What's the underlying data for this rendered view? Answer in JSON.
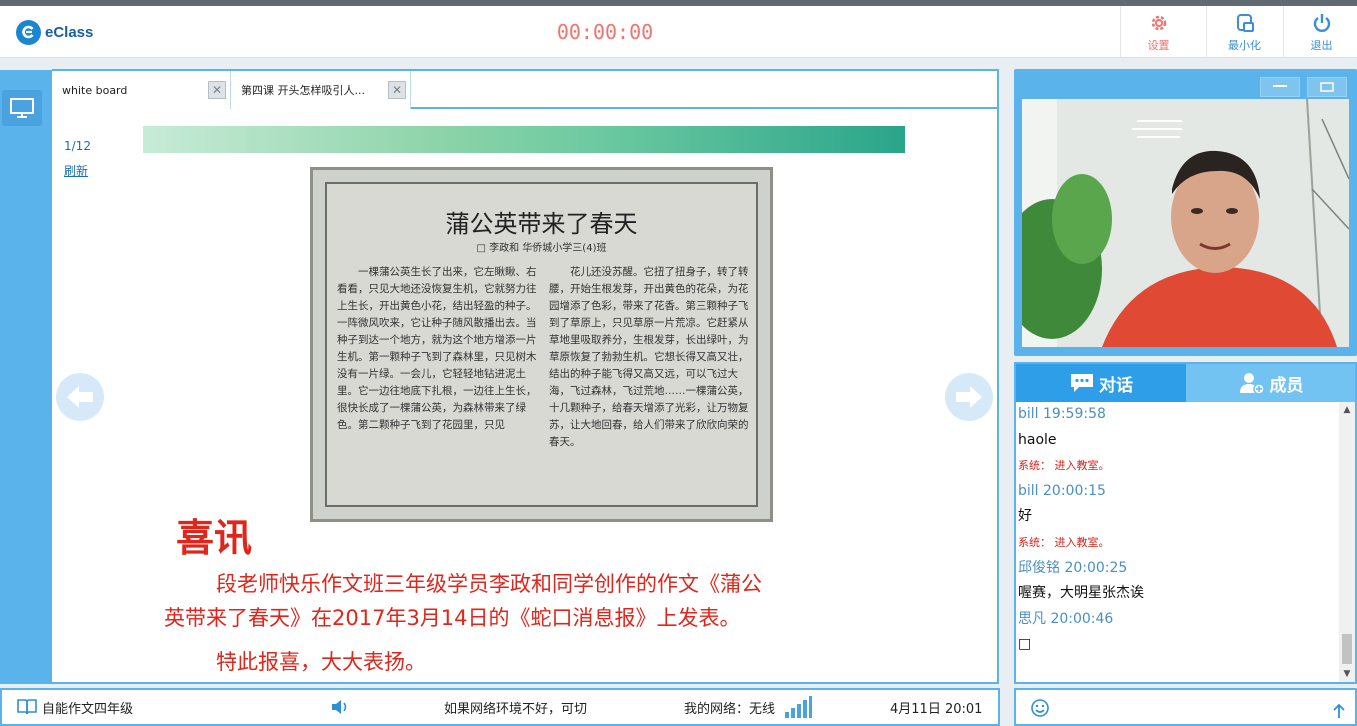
{
  "app": {
    "logo_text": "eClass"
  },
  "timer": "00:00:00",
  "toolbar": {
    "settings_label": "设置",
    "minimize_label": "最小化",
    "exit_label": "退出"
  },
  "tabs": [
    {
      "label": "white board"
    },
    {
      "label": "第四课 开头怎样吸引人..."
    }
  ],
  "slide": {
    "page_info": "1/12",
    "refresh_label": "刷新",
    "newspaper_title": "蒲公英带来了春天",
    "newspaper_byline": "□ 李政和 华侨城小学三(4)班",
    "newspaper_col1": "一棵蒲公英生长了出来，它左瞅瞅、右看看，只见大地还没恢复生机，它就努力往上生长，开出黄色小花，结出轻盈的种子。一阵微风吹来，它让种子随风散播出去。当种子到达一个地方，就为这个地方增添一片生机。第一颗种子飞到了森林里，只见树木没有一片绿。一会儿，它轻轻地钻进泥土里。它一边往地底下扎根，一边往上生长，很快长成了一棵蒲公英，为森林带来了绿色。第二颗种子飞到了花园里，只见",
    "newspaper_col2": "花儿还没苏醒。它扭了扭身子，转了转腰，开始生根发芽，开出黄色的花朵，为花园增添了色彩，带来了花香。第三颗种子飞到了草原上，只见草原一片荒凉。它赶紧从草地里吸取养分，生根发芽，长出绿叶，为草原恢复了勃勃生机。它想长得又高又壮，结出的种子能飞得又高又远，可以飞过大海，飞过森林，飞过荒地……一棵蒲公英，十几颗种子，给春天增添了光彩，让万物复苏，让大地回春，给人们带来了欣欣向荣的春天。",
    "headline": "喜讯",
    "announce_line1": "段老师快乐作文班三年级学员李政和同学创作的作文《蒲公",
    "announce_line2": "英带来了春天》在2017年3月14日的《蛇口消息报》上发表。",
    "announce_line3": "特此报喜，大大表扬。"
  },
  "chat": {
    "tab_chat": "对话",
    "tab_members": "成员",
    "messages": [
      {
        "type": "sender",
        "text": "bill 19:59:58"
      },
      {
        "type": "body",
        "text": "haole"
      },
      {
        "type": "sys",
        "text": "系统： 进入教室。"
      },
      {
        "type": "sender",
        "text": "bill 20:00:15"
      },
      {
        "type": "body",
        "text": "好"
      },
      {
        "type": "sys",
        "text": "系统： 进入教室。"
      },
      {
        "type": "sender",
        "text": "邱俊铭 20:00:25"
      },
      {
        "type": "body",
        "text": "喔赛，大明星张杰诶"
      },
      {
        "type": "sender",
        "text": "思凡 20:00:46"
      },
      {
        "type": "body",
        "text": "□"
      }
    ]
  },
  "status": {
    "course_name": "自能作文四年级",
    "network_hint": "如果网络环境不好，可切",
    "network_label": "我的网络：无线",
    "datetime": "4月11日 20:01"
  },
  "colors": {
    "accent": "#5bb3ec",
    "timer": "#f2736b",
    "announce": "#e0261b",
    "chat_sender": "#4a8fc4",
    "chat_system": "#d4251c"
  }
}
